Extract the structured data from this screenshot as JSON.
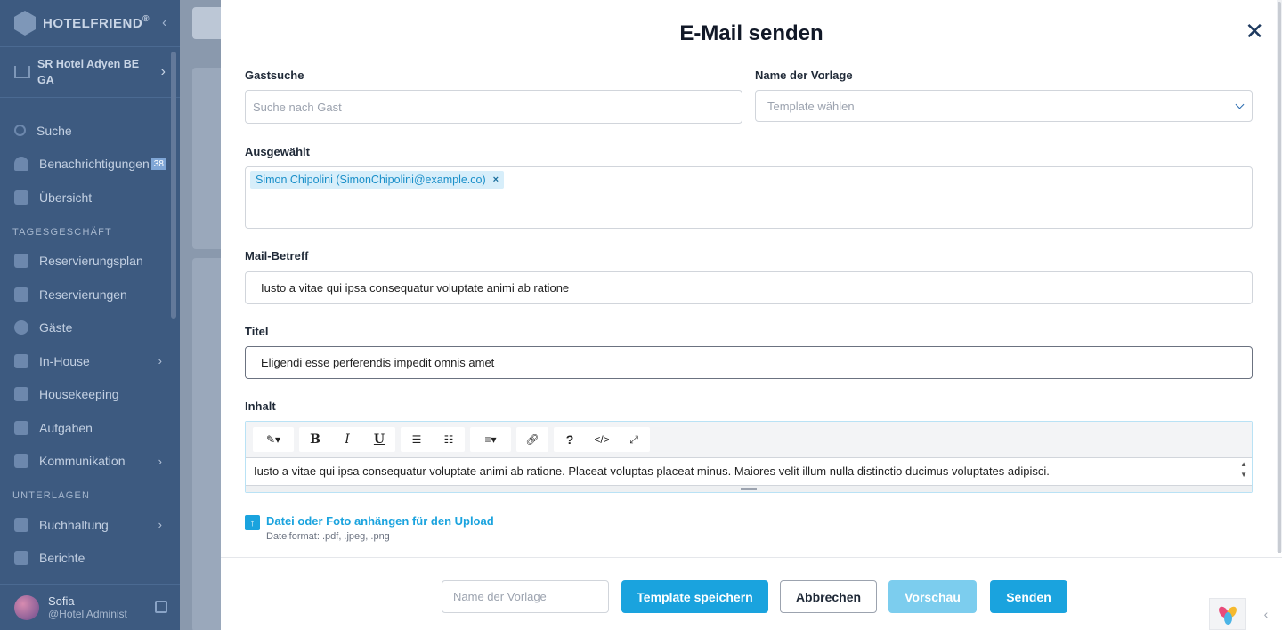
{
  "sidebar": {
    "brand": "HOTELFRIEND",
    "brand_mark": "®",
    "hotel_name": "SR Hotel Adyen BE GA",
    "items": [
      {
        "label": "Suche"
      },
      {
        "label": "Benachrichtigungen",
        "badge": "38"
      },
      {
        "label": "Übersicht"
      }
    ],
    "section_daily": "TAGESGESCHÄFT",
    "daily_items": [
      {
        "label": "Reservierungsplan"
      },
      {
        "label": "Reservierungen"
      },
      {
        "label": "Gäste"
      },
      {
        "label": "In-House"
      },
      {
        "label": "Housekeeping"
      },
      {
        "label": "Aufgaben"
      },
      {
        "label": "Kommunikation"
      }
    ],
    "section_docs": "UNTERLAGEN",
    "docs_items": [
      {
        "label": "Buchhaltung"
      },
      {
        "label": "Berichte"
      }
    ],
    "user": {
      "name": "Sofia",
      "role": "@Hotel Administ"
    }
  },
  "modal": {
    "title": "E-Mail senden",
    "guest_search": {
      "label": "Gastsuche",
      "placeholder": "Suche nach Gast"
    },
    "template_name": {
      "label": "Name der Vorlage",
      "placeholder": "Template wählen"
    },
    "selected": {
      "label": "Ausgewählt",
      "tag": "Simon Chipolini (SimonChipolini@example.co)",
      "tag_remove": "×"
    },
    "subject": {
      "label": "Mail-Betreff",
      "value": "Iusto a vitae qui ipsa consequatur voluptate animi ab ratione"
    },
    "heading": {
      "label": "Titel",
      "value": "Eligendi esse perferendis impedit omnis amet"
    },
    "content": {
      "label": "Inhalt",
      "value": "Iusto a vitae qui ipsa consequatur voluptate animi ab ratione. Placeat voluptas placeat minus. Maiores velit illum nulla distinctio ducimus voluptates adipisci.",
      "toolbar": {
        "bold": "B",
        "italic": "I",
        "underline": "U",
        "help": "?",
        "code": "</>"
      }
    },
    "upload": {
      "link": "Datei oder Foto anhängen für den Upload",
      "hint": "Dateiformat: .pdf, .jpeg, .png"
    },
    "footer": {
      "template_input_placeholder": "Name der Vorlage",
      "save_template": "Template speichern",
      "cancel": "Abbrechen",
      "preview": "Vorschau",
      "send": "Senden"
    }
  },
  "colors": {
    "accent": "#1aa3de",
    "sidebar": "#3d5a80",
    "tag_bg": "#d7eefa"
  }
}
